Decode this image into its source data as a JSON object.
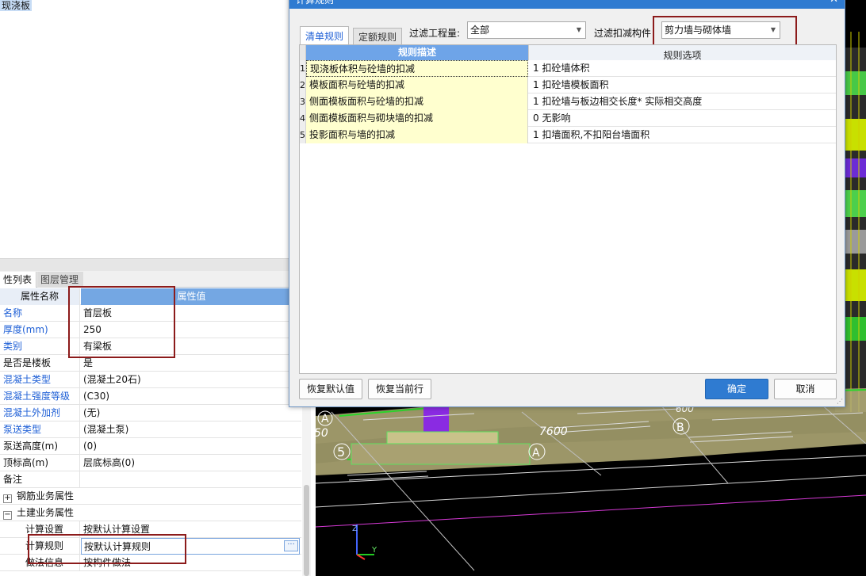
{
  "left": {
    "tree_node": "现浇板",
    "tabs": [
      "性列表",
      "图层管理"
    ],
    "header": {
      "name": "属性名称",
      "value": "属性值"
    },
    "rows": [
      {
        "name": "名称",
        "value": "首层板",
        "blue": true
      },
      {
        "name": "厚度(mm)",
        "value": "250",
        "blue": true
      },
      {
        "name": "类别",
        "value": "有梁板",
        "blue": true
      },
      {
        "name": "是否是楼板",
        "value": "是",
        "blue": false
      },
      {
        "name": "混凝土类型",
        "value": "(混凝土20石)",
        "blue": true
      },
      {
        "name": "混凝土强度等级",
        "value": "(C30)",
        "blue": true
      },
      {
        "name": "混凝土外加剂",
        "value": "(无)",
        "blue": true
      },
      {
        "name": "泵送类型",
        "value": "(混凝土泵)",
        "blue": true
      },
      {
        "name": "泵送高度(m)",
        "value": "(0)",
        "blue": false
      },
      {
        "name": "顶标高(m)",
        "value": "层底标高(0)",
        "blue": false
      },
      {
        "name": "备注",
        "value": "",
        "blue": false
      }
    ],
    "groups": [
      {
        "sign": "+",
        "label": "钢筋业务属性"
      },
      {
        "sign": "−",
        "label": "土建业务属性"
      }
    ],
    "sub_rows": [
      {
        "name": "计算设置",
        "value": "按默认计算设置"
      },
      {
        "name": "计算规则",
        "value": "按默认计算规则",
        "button": "···"
      },
      {
        "name": "做法信息",
        "value": "按构件做法"
      }
    ]
  },
  "viewport": {
    "labels": {
      "axis_a1": "A",
      "axis_a2": "A",
      "axis_b": "B",
      "num_5": "5",
      "dim_7600": "7600",
      "dim_50": "50",
      "dim_600": "600",
      "axis_y": "Y",
      "axis_z": "Z"
    }
  },
  "dialog": {
    "title": "计算规则",
    "close": "✕",
    "tabs": [
      "清单规则",
      "定额规则"
    ],
    "filter_quantity_label": "过滤工程量:",
    "filter_quantity_value": "全部",
    "filter_member_label": "过滤扣减构件",
    "filter_member_value": "剪力墙与砌体墙",
    "grid_header": {
      "desc": "规则描述",
      "option": "规则选项"
    },
    "rules": [
      {
        "no": "1",
        "desc": "现浇板体积与砼墙的扣减",
        "option": "1  扣砼墙体积"
      },
      {
        "no": "2",
        "desc": "模板面积与砼墙的扣减",
        "option": "1  扣砼墙模板面积"
      },
      {
        "no": "3",
        "desc": "侧面模板面积与砼墙的扣减",
        "option": "1  扣砼墙与板边相交长度* 实际相交高度"
      },
      {
        "no": "4",
        "desc": "侧面模板面积与砌块墙的扣减",
        "option": "0  无影响"
      },
      {
        "no": "5",
        "desc": "投影面积与墙的扣减",
        "option": "1  扣墙面积,不扣阳台墙面积"
      }
    ],
    "buttons": {
      "restore_default": "恢复默认值",
      "restore_row": "恢复当前行",
      "ok": "确定",
      "cancel": "取消"
    }
  },
  "colors": {
    "accent": "#2f7bd1",
    "highlight_box": "#8c1b1b",
    "rule_desc_bg": "#ffffcf"
  }
}
